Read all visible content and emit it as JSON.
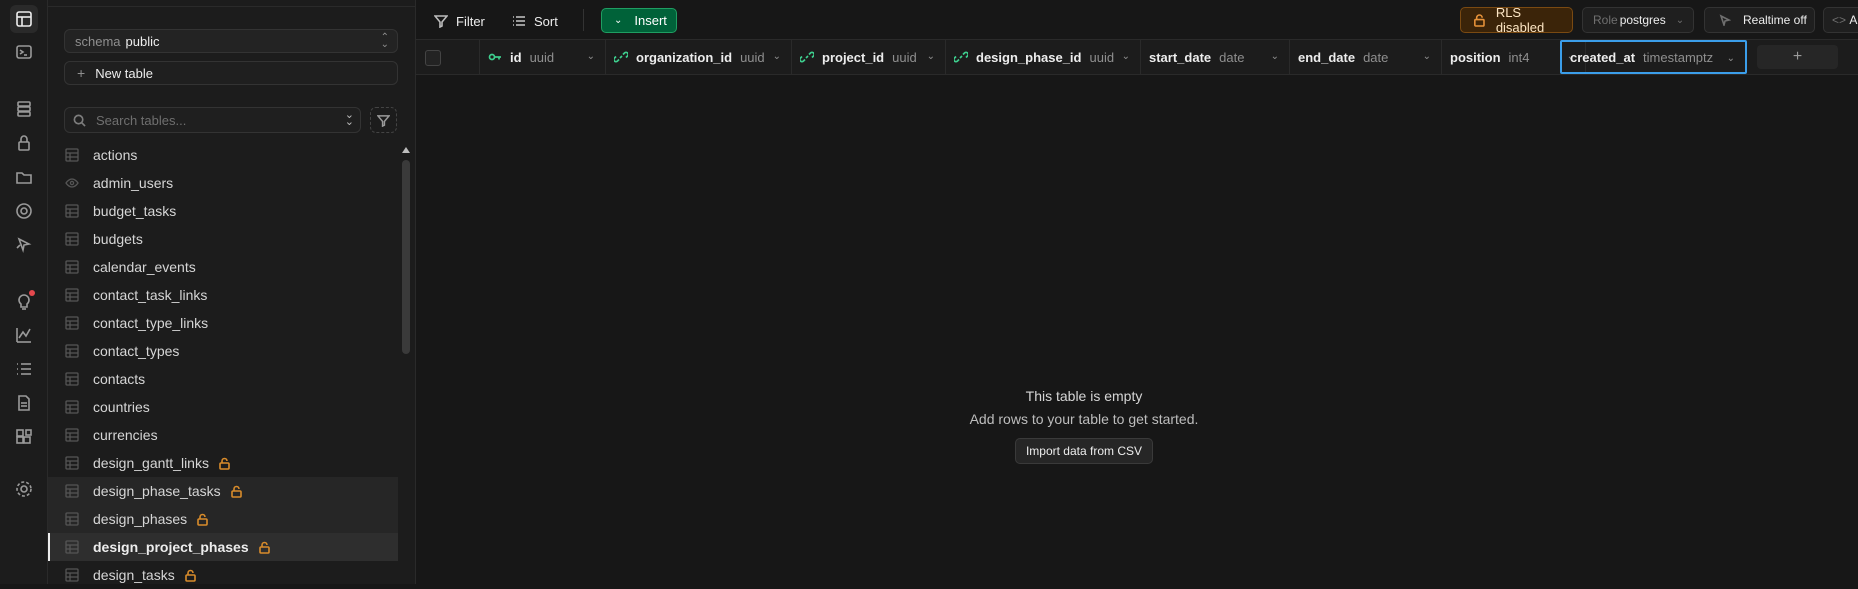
{
  "sidebar": {
    "schema_label": "schema",
    "schema_value": "public",
    "new_table_label": "New table",
    "search_placeholder": "Search tables...",
    "tables": [
      {
        "name": "actions",
        "icon": "table-icon"
      },
      {
        "name": "admin_users",
        "icon": "view-eye-icon"
      },
      {
        "name": "budget_tasks",
        "icon": "table-icon"
      },
      {
        "name": "budgets",
        "icon": "table-icon"
      },
      {
        "name": "calendar_events",
        "icon": "table-icon"
      },
      {
        "name": "contact_task_links",
        "icon": "table-icon"
      },
      {
        "name": "contact_type_links",
        "icon": "table-icon"
      },
      {
        "name": "contact_types",
        "icon": "table-icon"
      },
      {
        "name": "contacts",
        "icon": "table-icon"
      },
      {
        "name": "countries",
        "icon": "table-icon"
      },
      {
        "name": "currencies",
        "icon": "table-icon"
      },
      {
        "name": "design_gantt_links",
        "icon": "table-icon",
        "locked": true
      },
      {
        "name": "design_phase_tasks",
        "icon": "table-icon",
        "locked": true
      },
      {
        "name": "design_phases",
        "icon": "table-icon",
        "locked": true
      },
      {
        "name": "design_project_phases",
        "icon": "table-icon",
        "locked": true,
        "active": true
      },
      {
        "name": "design_tasks",
        "icon": "table-icon",
        "locked": true
      }
    ]
  },
  "toolbar": {
    "filter_label": "Filter",
    "sort_label": "Sort",
    "insert_label": "Insert",
    "rls_label": "RLS disabled",
    "role_label": "Role",
    "role_value": "postgres",
    "realtime_label": "Realtime off",
    "api_label": "A"
  },
  "columns": [
    {
      "name": "id",
      "type": "uuid",
      "icon": "key-icon"
    },
    {
      "name": "organization_id",
      "type": "uuid",
      "icon": "link-icon"
    },
    {
      "name": "project_id",
      "type": "uuid",
      "icon": "link-icon"
    },
    {
      "name": "design_phase_id",
      "type": "uuid",
      "icon": "link-icon"
    },
    {
      "name": "start_date",
      "type": "date"
    },
    {
      "name": "end_date",
      "type": "date"
    },
    {
      "name": "position",
      "type": "int4"
    },
    {
      "name": "created_at",
      "type": "timestamptz",
      "selected": true
    }
  ],
  "empty_state": {
    "title": "This table is empty",
    "subtitle": "Add rows to your table to get started.",
    "import_label": "Import data from CSV"
  },
  "colors": {
    "accent_green": "#006239",
    "warning_orange": "#d98c2b",
    "selection_blue": "#3b9eea"
  }
}
